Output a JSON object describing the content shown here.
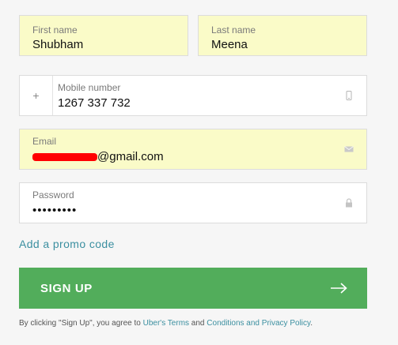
{
  "form": {
    "first_name": {
      "label": "First name",
      "value": "Shubham"
    },
    "last_name": {
      "label": "Last name",
      "value": "Meena"
    },
    "mobile": {
      "prefix": "+",
      "label": "Mobile number",
      "value": "1267 337 732",
      "icon": "phone-icon"
    },
    "email": {
      "label": "Email",
      "value_suffix": "@gmail.com",
      "icon": "mail-icon"
    },
    "password": {
      "label": "Password",
      "value": "•••••••••",
      "icon": "lock-icon"
    }
  },
  "promo_link": "Add a promo code",
  "signup_button": {
    "label": "SIGN UP",
    "icon": "arrow-right-icon"
  },
  "terms": {
    "prefix": "By clicking \"Sign Up\", you agree to ",
    "terms_link": "Uber's Terms",
    "middle": " and ",
    "policy_link": "Conditions and Privacy Policy",
    "suffix": "."
  },
  "colors": {
    "autofill": "#fafbc8",
    "button": "#52ad5b",
    "link": "#3b8fa0",
    "redaction": "#ff0000"
  }
}
